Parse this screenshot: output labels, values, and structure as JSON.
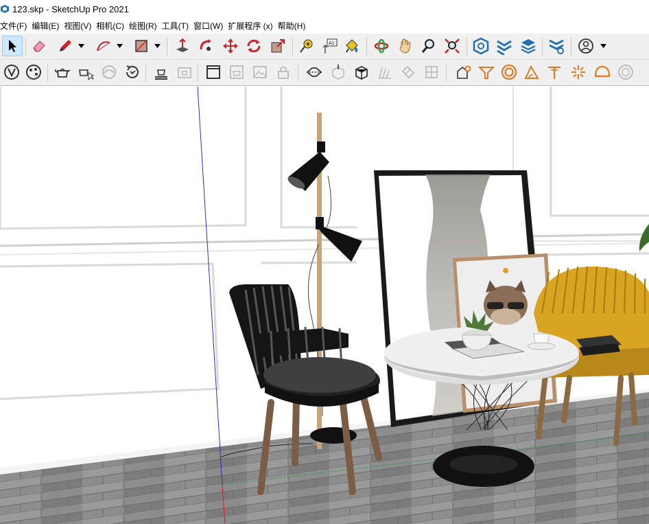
{
  "window": {
    "title": "123.skp - SketchUp Pro 2021"
  },
  "menu": {
    "items": [
      "文件(F)",
      "编辑(E)",
      "视图(V)",
      "相机(C)",
      "绘图(R)",
      "工具(T)",
      "窗口(W)",
      "扩展程序 (x)",
      "帮助(H)"
    ]
  },
  "toolbar1": {
    "tools": [
      "select-icon",
      "eraser-icon",
      "pencil-line-icon",
      "arc-icon",
      "rectangle-icon",
      "push-pull-icon",
      "follow-me-icon",
      "move-icon",
      "rotate-icon",
      "scale-icon",
      "tape-measure-icon",
      "text-label-icon",
      "paint-bucket-icon",
      "orbit-icon",
      "pan-icon",
      "zoom-icon",
      "zoom-extents-icon",
      "warehouse-icon",
      "extension-warehouse-icon",
      "layout-icon",
      "extension-manager-icon",
      "account-icon"
    ],
    "text_tool_label": "A1"
  },
  "toolbar2": {
    "tools": [
      "sandbox-icon",
      "styles-icon",
      "teapot-icon",
      "teapot-click-icon",
      "hidden-icon",
      "refresh-icon",
      "scene-icon",
      "scene-2-icon",
      "window-icon",
      "teapot-box-icon",
      "image-icon",
      "lock-icon",
      "section-icon",
      "box-export-icon",
      "box-solid-icon",
      "hatch-icon",
      "fold-icon",
      "grid-icon",
      "house-gear-icon",
      "funnel-icon",
      "circle-ring-icon",
      "ruler-triangle-icon",
      "t-post-icon",
      "burst-icon",
      "dome-icon",
      "sphere-icon"
    ]
  },
  "colors": {
    "accent_red": "#cc2229",
    "accent_orange": "#e07b22",
    "accent_blue": "#1f6fb2",
    "toolbar_bg": "#f0f0f0"
  }
}
